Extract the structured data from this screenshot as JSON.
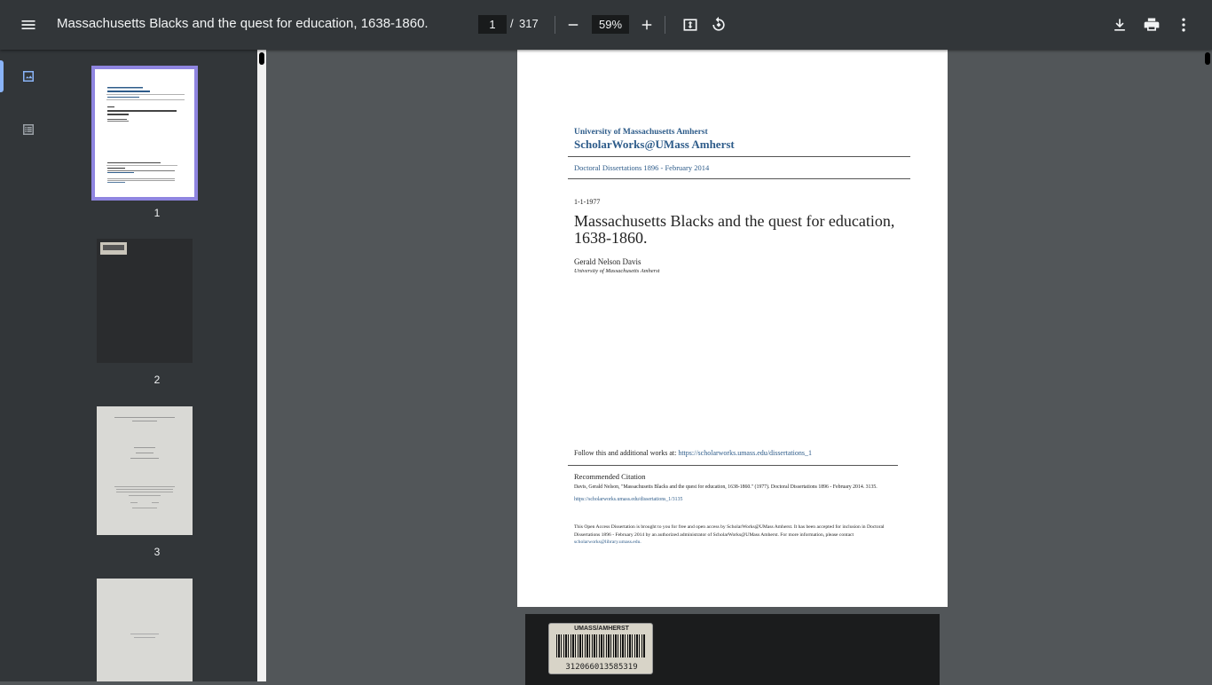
{
  "toolbar": {
    "title": "Massachusetts Blacks and the quest for education, 1638-1860.",
    "current_page": "1",
    "page_separator": "/",
    "total_pages": "317",
    "zoom": "59%"
  },
  "rail": {
    "items": [
      {
        "icon": "thumbnail-icon",
        "active": true
      },
      {
        "icon": "outline-icon",
        "active": false
      }
    ]
  },
  "thumbnails": [
    {
      "label": "1"
    },
    {
      "label": "2"
    },
    {
      "label": "3"
    }
  ],
  "document": {
    "institution": "University of Massachusetts Amherst",
    "repository": "ScholarWorks@UMass Amherst",
    "collection": "Doctoral Dissertations 1896 - February 2014",
    "date": "1-1-1977",
    "title": "Massachusetts Blacks and the quest for education, 1638-1860.",
    "author": "Gerald Nelson Davis",
    "affiliation": "University of Massachusetts Amherst",
    "follow_text": "Follow this and additional works at:",
    "follow_link": "https://scholarworks.umass.edu/dissertations_1",
    "recommended_heading": "Recommended Citation",
    "recommended_text": "Davis, Gerald Nelson, \"Massachusetts Blacks and the quest for education, 1638-1860.\" (1977). Doctoral Dissertations 1896 - February 2014. 3135.",
    "recommended_link": "https://scholarworks.umass.edu/dissertations_1/3135",
    "oa_text": "This Open Access Dissertation is brought to you for free and open access by ScholarWorks@UMass Amherst. It has been accepted for inclusion in Doctoral Dissertations 1896 - February 2014 by an authorized administrator of ScholarWorks@UMass Amherst. For more information, please contact",
    "oa_email": "scholarworks@library.umass.edu."
  },
  "page2": {
    "label_title": "UMASS/AMHERST",
    "barcode_number": "312066013585319"
  }
}
